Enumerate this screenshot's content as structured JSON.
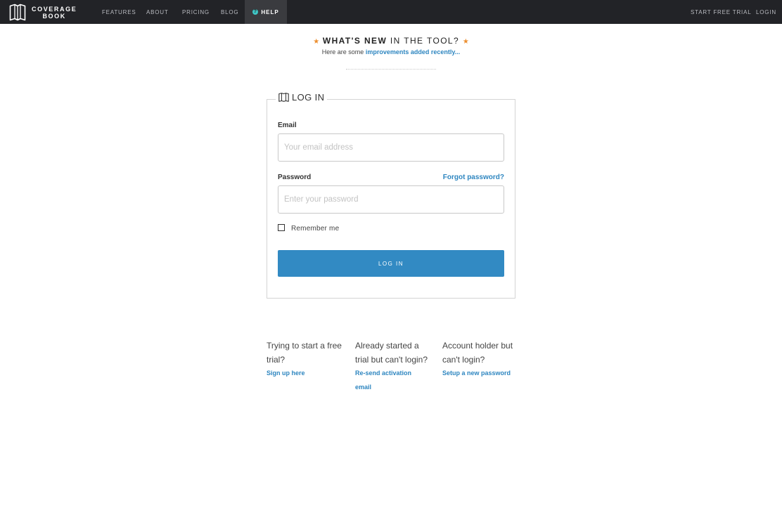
{
  "brand": {
    "line1": "COVERAGE",
    "line2": "BOOK"
  },
  "nav": {
    "features": "FEATURES",
    "about": "ABOUT",
    "pricing": "PRICING",
    "blog": "BLOG",
    "help": "HELP",
    "start_trial": "START FREE TRIAL",
    "login": "LOGIN"
  },
  "whats_new": {
    "star": "★",
    "bold": "WHAT'S NEW",
    "rest": "IN THE TOOL?",
    "sub_prefix": "Here are some",
    "sub_link": "improvements added recently..."
  },
  "login_form": {
    "legend": "LOG IN",
    "email_label": "Email",
    "email_placeholder": "Your email address",
    "email_value": "",
    "password_label": "Password",
    "forgot_link": "Forgot password?",
    "password_placeholder": "Enter your password",
    "password_value": "",
    "remember_label": "Remember me",
    "remember_checked": false,
    "submit_label": "LOG IN"
  },
  "help_links": [
    {
      "question": "Trying to start a free trial?",
      "link": "Sign up here"
    },
    {
      "question": "Already started a trial but can't login?",
      "link": "Re-send activation email"
    },
    {
      "question": "Account holder but can't login?",
      "link": "Setup a new password"
    }
  ],
  "colors": {
    "topbar": "#222327",
    "accent": "#328ac3",
    "link": "#2e86c0",
    "star": "#ec8f30",
    "help_icon": "#3fc6c6"
  },
  "icons": {
    "logo": "book-logo-icon",
    "help": "question-circle-icon",
    "legend": "book-icon",
    "star": "star-icon"
  }
}
